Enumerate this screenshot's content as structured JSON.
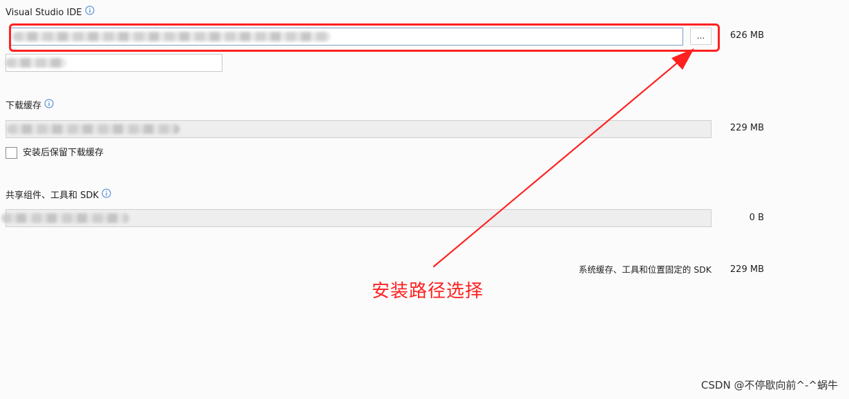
{
  "ide_section": {
    "title": "Visual Studio IDE",
    "size": "626 MB",
    "browse_label": "..."
  },
  "download_cache": {
    "title": "下载缓存",
    "size": "229 MB",
    "keep_cache_label": "安装后保留下载缓存"
  },
  "shared_components": {
    "title": "共享组件、工具和 SDK",
    "size": "0 B"
  },
  "summary": {
    "label": "系统缓存、工具和位置固定的 SDK",
    "size": "229 MB"
  },
  "annotation": {
    "text": "安装路径选择"
  },
  "watermark": {
    "text": "CSDN @不停歇向前^-^蜗牛"
  },
  "colors": {
    "annotation": "#ff2020",
    "info_icon": "#3a7fd6"
  }
}
